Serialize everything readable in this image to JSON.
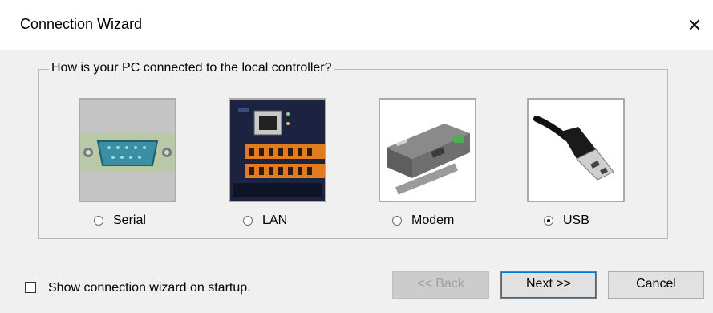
{
  "window": {
    "title": "Connection Wizard",
    "close_glyph": "✕"
  },
  "group": {
    "legend": "How is your PC connected to the local controller?"
  },
  "options": [
    {
      "label": "Serial",
      "selected": false,
      "icon": "serial-port-image"
    },
    {
      "label": "LAN",
      "selected": false,
      "icon": "lan-controller-image"
    },
    {
      "label": "Modem",
      "selected": false,
      "icon": "modem-device-image"
    },
    {
      "label": "USB",
      "selected": true,
      "icon": "usb-cable-image"
    }
  ],
  "startup": {
    "label": "Show connection wizard on startup.",
    "checked": false
  },
  "buttons": {
    "back": "<< Back",
    "next": "Next >>",
    "cancel": "Cancel"
  },
  "colors": {
    "dialog_bg": "#f0f0f0",
    "focus_accent": "#0078d7"
  }
}
